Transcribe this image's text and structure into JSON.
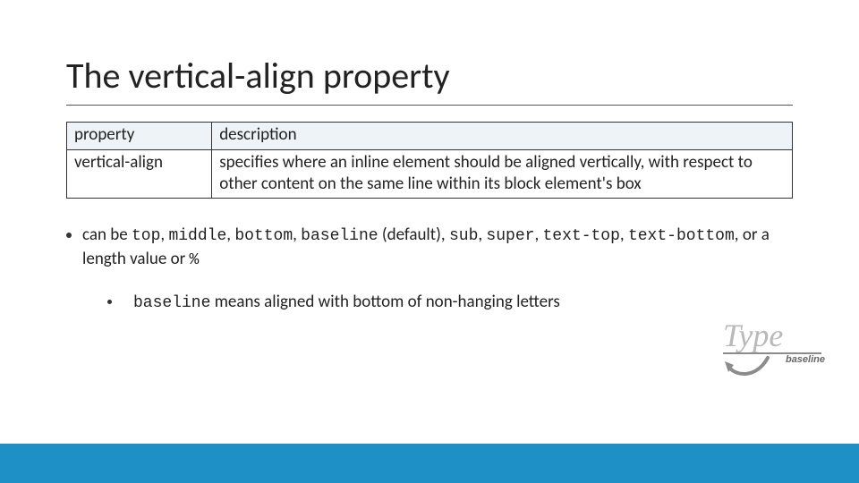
{
  "title": "The vertical-align property",
  "table": {
    "headers": [
      "property",
      "description"
    ],
    "row": {
      "property": "vertical-align",
      "description": "specifies where an inline element should be aligned vertically, with respect to other content on the same line within its block element's box"
    }
  },
  "bullets": {
    "line1": {
      "pre": "can be ",
      "tokens": [
        "top",
        "middle",
        "bottom",
        "baseline",
        "sub",
        "super",
        "text-top",
        "text-bottom"
      ],
      "default_note": " (default)",
      "post": ", or a length value or ",
      "percent": "%"
    },
    "line2": {
      "code": "baseline",
      "rest": " means aligned with bottom of non-hanging letters"
    }
  },
  "figure": {
    "word": "Type",
    "label": "baseline"
  }
}
